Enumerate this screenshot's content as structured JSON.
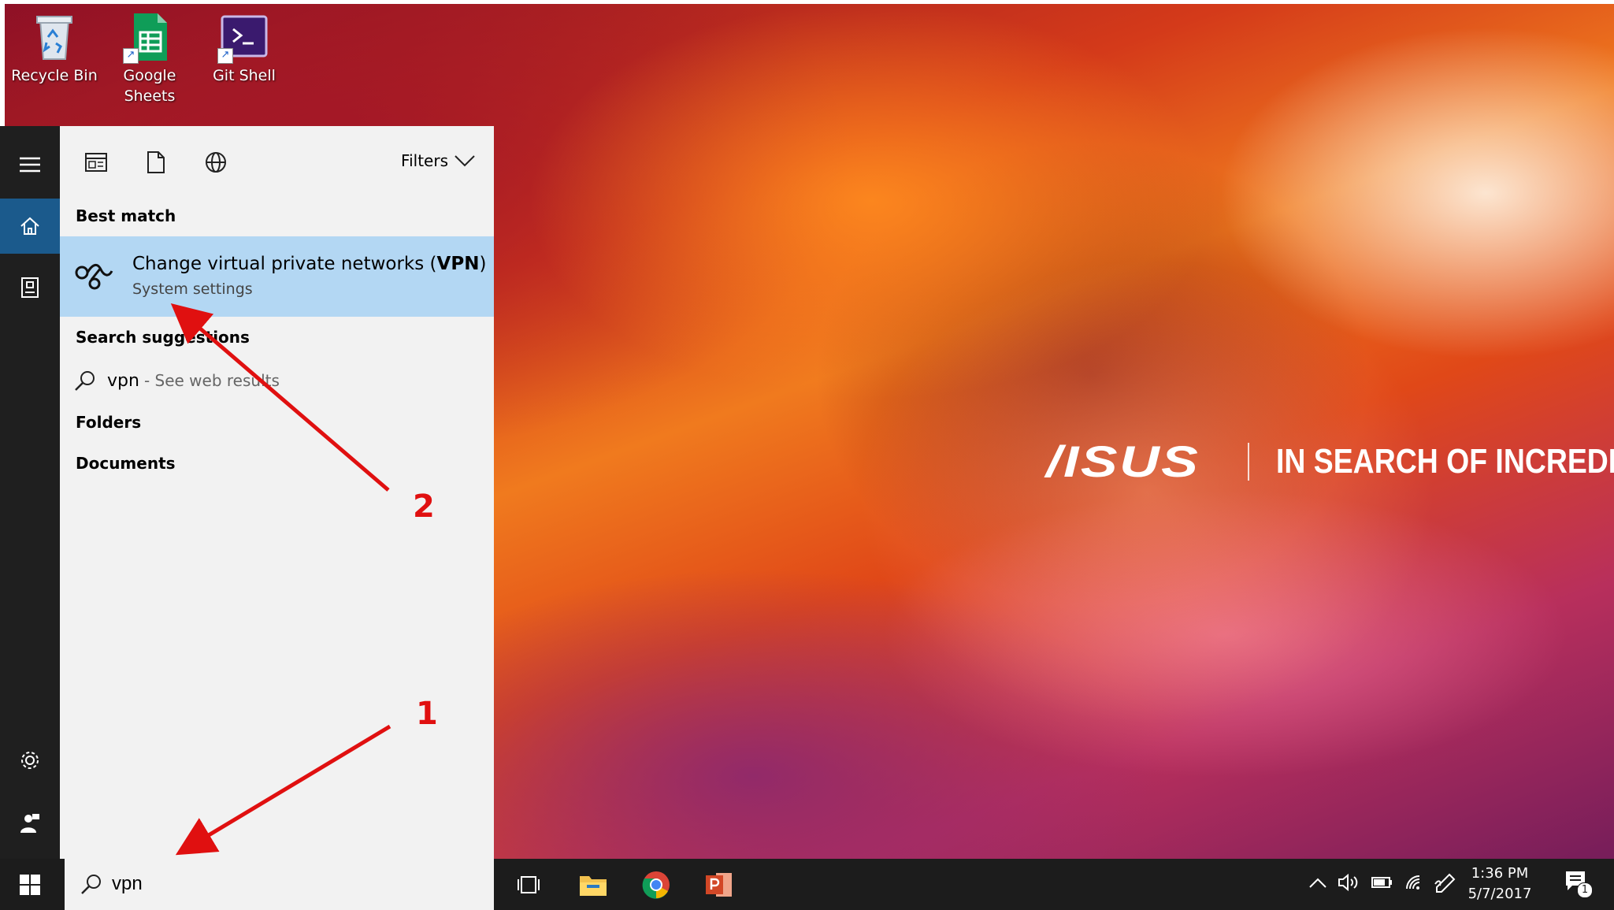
{
  "desktop_icons": [
    {
      "label": "Recycle Bin",
      "icon": "recycle-bin-icon"
    },
    {
      "label": "Google Sheets",
      "icon": "google-sheets-icon"
    },
    {
      "label": "Git Shell",
      "icon": "git-shell-icon"
    }
  ],
  "search_panel": {
    "filters_label": "Filters",
    "sections": {
      "best_match": "Best match",
      "search_suggestions": "Search suggestions",
      "folders": "Folders",
      "documents": "Documents"
    },
    "best_match_item": {
      "title_prefix": "Change virtual private networks (",
      "title_bold": "VPN",
      "title_suffix": ")",
      "subtitle": "System settings",
      "icon": "vpn-icon"
    },
    "suggestion": {
      "query": "vpn",
      "hint": "- See web results"
    }
  },
  "taskbar": {
    "search_value": "vpn",
    "clock_time": "1:36 PM",
    "clock_date": "5/7/2017",
    "notification_count": "1",
    "accent_color": "#1b5a8c"
  },
  "wallpaper": {
    "brand": "/ISUS",
    "tagline": "IN SEARCH OF INCREDIBLE"
  },
  "annotations": [
    {
      "label": "1",
      "color": "#e01010"
    },
    {
      "label": "2",
      "color": "#e01010"
    }
  ]
}
